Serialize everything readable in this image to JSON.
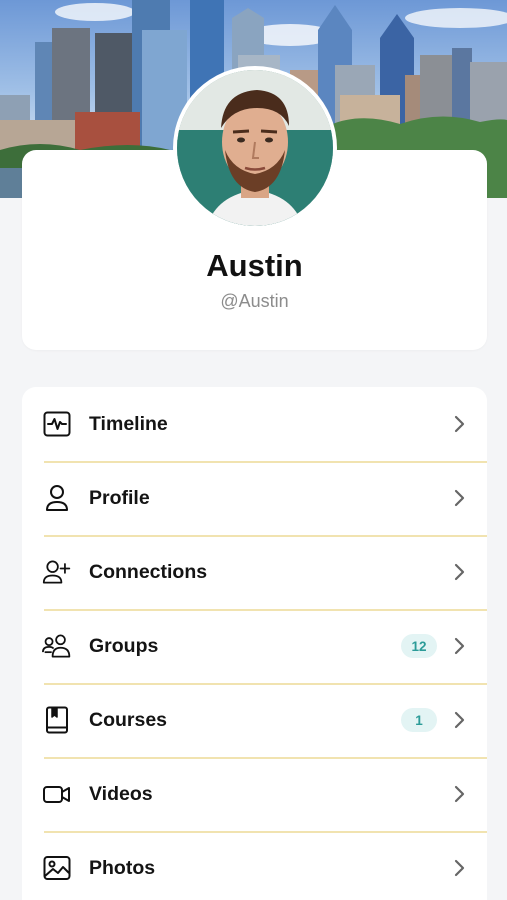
{
  "profile": {
    "name": "Austin",
    "handle": "@Austin"
  },
  "menu": [
    {
      "label": "Timeline",
      "icon": "activity-icon",
      "badge": null
    },
    {
      "label": "Profile",
      "icon": "person-icon",
      "badge": null
    },
    {
      "label": "Connections",
      "icon": "add-person-icon",
      "badge": null
    },
    {
      "label": "Groups",
      "icon": "group-icon",
      "badge": "12"
    },
    {
      "label": "Courses",
      "icon": "book-icon",
      "badge": "1"
    },
    {
      "label": "Videos",
      "icon": "video-camera-icon",
      "badge": null
    },
    {
      "label": "Photos",
      "icon": "photo-icon",
      "badge": null
    }
  ],
  "colors": {
    "accent": "#2b9b98",
    "badge_bg": "#e3f4f4",
    "divider": "#f1e3b0",
    "background": "#f4f5f7"
  }
}
